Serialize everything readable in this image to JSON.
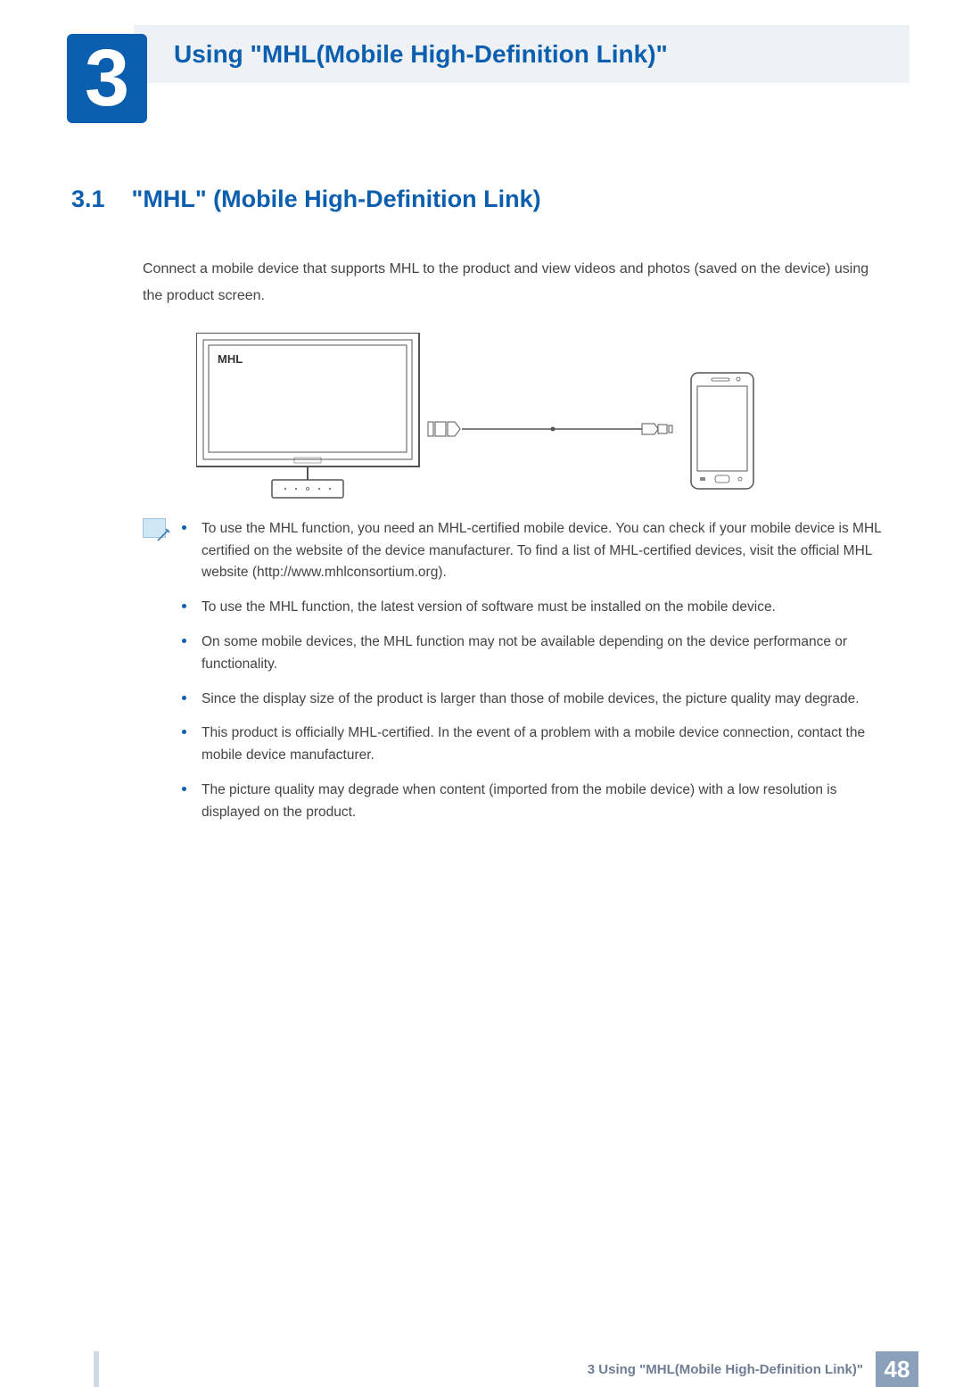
{
  "chapter": {
    "number": "3",
    "title": "Using \"MHL(Mobile High-Definition Link)\""
  },
  "section": {
    "number": "3.1",
    "title": "\"MHL\" (Mobile High-Definition Link)"
  },
  "intro": "Connect a mobile device that supports MHL to the product and view videos and photos (saved on the device) using the product screen.",
  "diagram": {
    "label": "MHL"
  },
  "notes": [
    "To use the MHL function, you need an MHL-certified mobile device. You can check if your mobile device is MHL certified on the website of the device manufacturer. To find a list of MHL-certified devices, visit the official MHL website (http://www.mhlconsortium.org).",
    "To use the MHL function, the latest version of software must be installed on the mobile device.",
    "On some mobile devices, the MHL function may not be available depending on the device performance or functionality.",
    "Since the display size of the product is larger than those of mobile devices, the picture quality may degrade.",
    "This product is officially MHL-certified. In the event of a problem with a mobile device connection, contact the mobile device manufacturer.",
    "The picture quality may degrade when content (imported from the mobile device) with a low resolution is displayed on the product."
  ],
  "footer": {
    "text": "3 Using \"MHL(Mobile High-Definition Link)\"",
    "page": "48"
  }
}
